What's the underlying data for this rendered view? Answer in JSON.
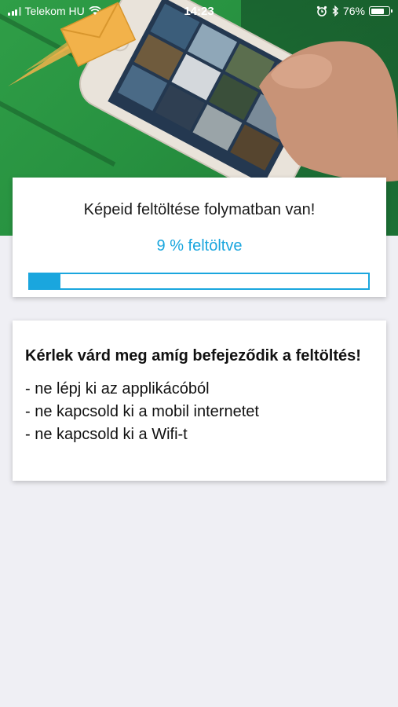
{
  "status_bar": {
    "carrier": "Telekom HU",
    "time": "14:23",
    "battery_percent": "76%",
    "battery_level": 0.76,
    "icons": [
      "signal-icon",
      "wifi-icon",
      "alarm-icon",
      "bluetooth-icon",
      "battery-icon"
    ]
  },
  "hero": {
    "icons": [
      "envelope-icon",
      "phone-photo"
    ],
    "colors": {
      "green": "#2a9a44",
      "envelope": "#f2b24a"
    }
  },
  "progress": {
    "title": "Képeid feltöltése folymatban van!",
    "percent_text": "9 % feltöltve",
    "value": 0.09,
    "accent_color": "#1aa6de"
  },
  "info": {
    "heading": "Kérlek várd meg amíg befejeződik a feltöltés!",
    "items": [
      "- ne lépj ki az applikácóból",
      "- ne kapcsold ki a mobil internetet",
      "- ne kapcsold ki a Wifi-t"
    ]
  }
}
